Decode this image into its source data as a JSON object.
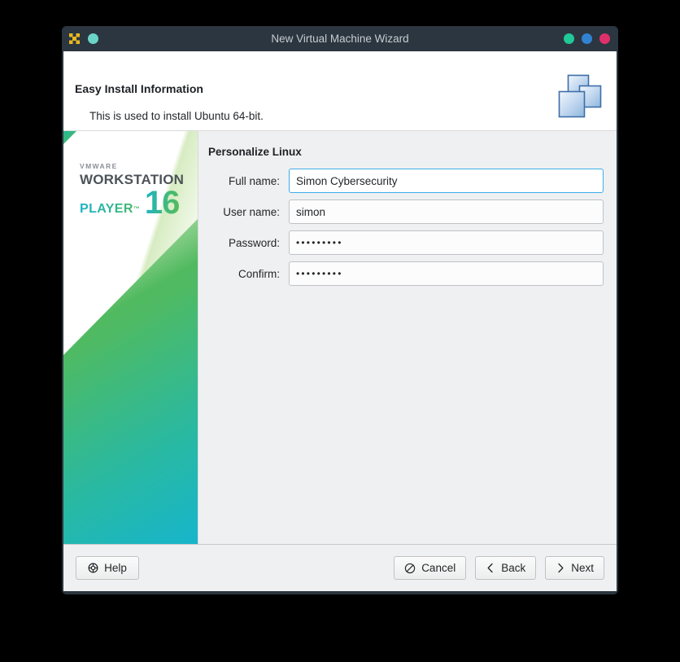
{
  "window": {
    "title": "New Virtual Machine Wizard",
    "app_icon": "vmware-app-icon",
    "titlebar_left_dot": "teal-dot",
    "controls": [
      {
        "name": "minimize-button",
        "color": "#20c997"
      },
      {
        "name": "maximize-button",
        "color": "#3282d2"
      },
      {
        "name": "close-button",
        "color": "#e0306a"
      }
    ]
  },
  "header": {
    "title": "Easy Install Information",
    "subtitle": "This is used to install Ubuntu 64-bit.",
    "logo_icon": "stacked-squares-icon"
  },
  "sidebar": {
    "brand_vmware": "VMWARE",
    "brand_product": "WORKSTATION",
    "brand_edition": "PLAYER",
    "brand_tm": "™",
    "brand_version": "16",
    "accent_teal": "#16b5cc",
    "accent_green": "#63bb4a"
  },
  "main": {
    "section_title": "Personalize Linux",
    "fields": [
      {
        "name": "full-name",
        "label": "Full name:",
        "value": "Simon Cybersecurity",
        "placeholder": "",
        "type": "text",
        "focused": true
      },
      {
        "name": "user-name",
        "label": "User name:",
        "value": "simon",
        "placeholder": "",
        "type": "text",
        "focused": false
      },
      {
        "name": "password",
        "label": "Password:",
        "value": "•••••••••",
        "placeholder": "",
        "type": "password",
        "focused": false
      },
      {
        "name": "confirm",
        "label": "Confirm:",
        "value": "•••••••••",
        "placeholder": "",
        "type": "password",
        "focused": false
      }
    ]
  },
  "footer": {
    "help_label": "Help",
    "help_icon": "lifebuoy-icon",
    "cancel_label": "Cancel",
    "cancel_icon": "prohibition-icon",
    "back_label": "Back",
    "back_icon": "chevron-left-icon",
    "next_label": "Next",
    "next_icon": "chevron-right-icon"
  }
}
